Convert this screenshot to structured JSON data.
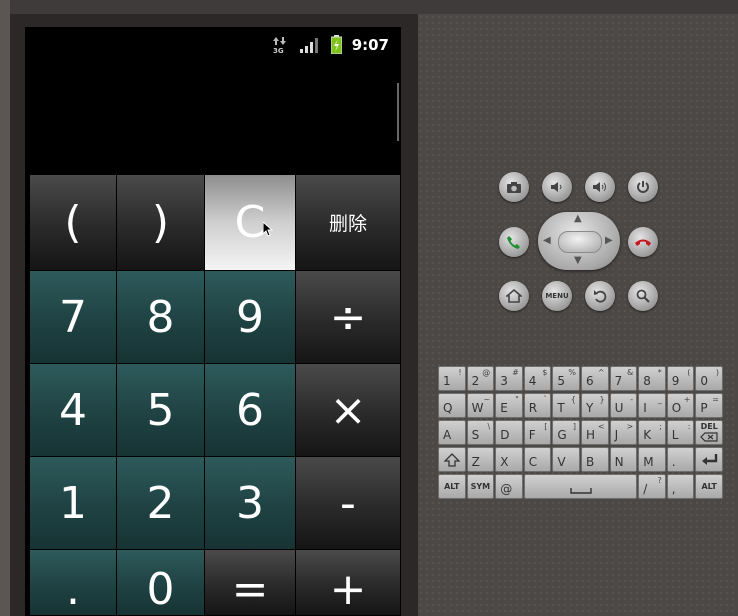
{
  "status": {
    "network": "3G",
    "time": "9:07"
  },
  "display": {
    "value": ""
  },
  "keys": {
    "open_paren": "(",
    "close_paren": ")",
    "clear": "C",
    "delete": "删除",
    "seven": "7",
    "eight": "8",
    "nine": "9",
    "divide": "÷",
    "four": "4",
    "five": "5",
    "six": "6",
    "multiply": "×",
    "one": "1",
    "two": "2",
    "three": "3",
    "minus": "-",
    "dot": ".",
    "zero": "0",
    "equals": "=",
    "plus": "+"
  },
  "controls": {
    "menu": "MENU"
  },
  "keyboard": {
    "row1": [
      [
        "1",
        "!"
      ],
      [
        "2",
        "@"
      ],
      [
        "3",
        "#"
      ],
      [
        "4",
        "$"
      ],
      [
        "5",
        "%"
      ],
      [
        "6",
        "^"
      ],
      [
        "7",
        "&"
      ],
      [
        "8",
        "*"
      ],
      [
        "9",
        "("
      ],
      [
        "0",
        ")"
      ]
    ],
    "row2": [
      [
        "Q",
        ""
      ],
      [
        "W",
        "~"
      ],
      [
        "E",
        "\""
      ],
      [
        "R",
        "`"
      ],
      [
        "T",
        "{"
      ],
      [
        "Y",
        "}"
      ],
      [
        "U",
        "-"
      ],
      [
        "I",
        "_"
      ],
      [
        "O",
        "+"
      ],
      [
        "P",
        "="
      ]
    ],
    "row3": [
      [
        "A",
        ""
      ],
      [
        "S",
        "\\"
      ],
      [
        "D",
        ""
      ],
      [
        "F",
        "["
      ],
      [
        "G",
        "]"
      ],
      [
        "H",
        "<"
      ],
      [
        "J",
        ">"
      ],
      [
        "K",
        ";"
      ],
      [
        "L",
        ":"
      ]
    ],
    "row4": [
      [
        "Z",
        ""
      ],
      [
        "X",
        ""
      ],
      [
        "C",
        ""
      ],
      [
        "V",
        ""
      ],
      [
        "B",
        ""
      ],
      [
        "N",
        ""
      ],
      [
        "M",
        ""
      ],
      [
        ".",
        ""
      ]
    ],
    "row5": [
      [
        "@",
        ""
      ],
      [
        "/",
        "?"
      ],
      [
        ",",
        ""
      ]
    ],
    "del": "DEL",
    "alt": "ALT",
    "sym": "SYM"
  },
  "colors": {
    "num_key": "#1f4243",
    "op_key": "#2a2a2a",
    "pressed_key": "#f4f4f4",
    "battery": "#7ec21a"
  }
}
